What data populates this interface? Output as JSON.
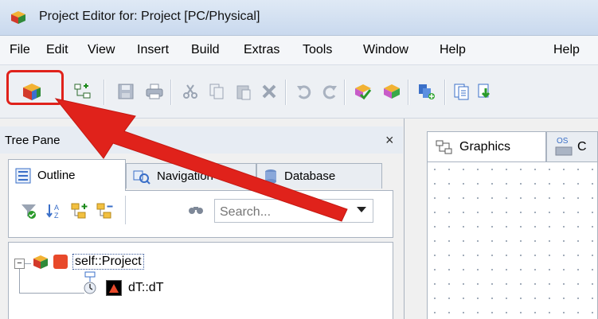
{
  "window": {
    "title": "Project Editor for: Project [PC/Physical]",
    "app_icon": "cube-icon"
  },
  "menu": [
    "File",
    "Edit",
    "View",
    "Insert",
    "Build",
    "Extras",
    "Tools",
    "Window",
    "Help"
  ],
  "toolbar": {
    "icons": [
      "cube-icon",
      "new-node-icon",
      "save-icon",
      "print-icon",
      "cut-icon",
      "copy-icon",
      "paste-icon",
      "delete-icon",
      "undo-icon",
      "redo-icon",
      "check-icon",
      "compile-icon",
      "export-icon",
      "document-icon",
      "download-icon"
    ],
    "highlight_color": "#e0221b"
  },
  "tree_pane": {
    "title": "Tree Pane",
    "close_glyph": "×",
    "tabs": [
      {
        "label": "Outline",
        "icon": "outline-icon",
        "active": true
      },
      {
        "label": "Navigation",
        "icon": "navigation-icon",
        "active": false
      },
      {
        "label": "Database",
        "icon": "database-icon",
        "active": false
      }
    ],
    "search_placeholder": "Search...",
    "tree": [
      {
        "label": "self::Project",
        "expander": "−",
        "selected": true
      },
      {
        "label": "dT::dT",
        "selected": false
      }
    ]
  },
  "editor_tabs": [
    {
      "label": "Graphics",
      "icon": "graphics-icon",
      "active": true
    },
    {
      "label": "C",
      "icon": "os-icon",
      "active": false
    }
  ],
  "os_icon_label": "OS"
}
